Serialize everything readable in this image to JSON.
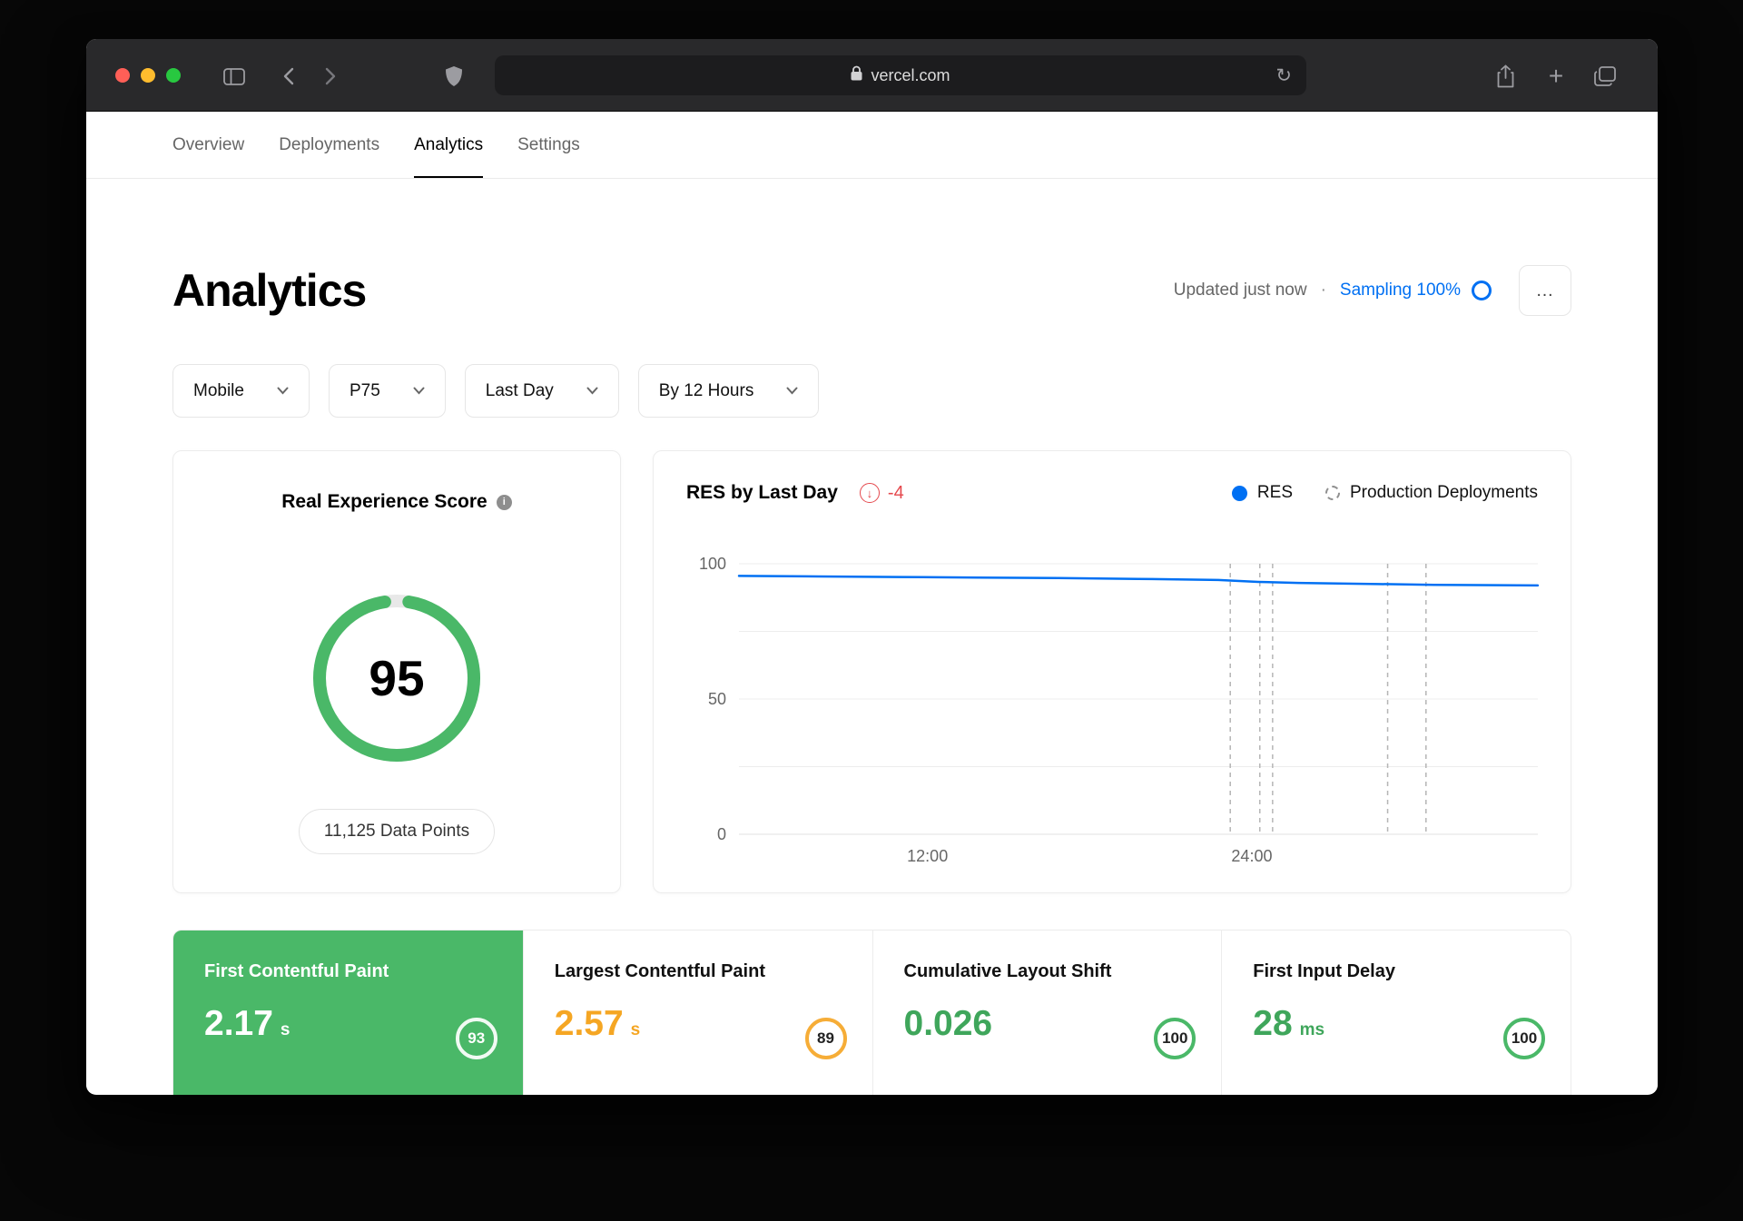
{
  "browser": {
    "url": "vercel.com",
    "refresh_glyph": "↻",
    "plus_glyph": "+"
  },
  "nav": {
    "tabs": [
      {
        "label": "Overview",
        "active": false
      },
      {
        "label": "Deployments",
        "active": false
      },
      {
        "label": "Analytics",
        "active": true
      },
      {
        "label": "Settings",
        "active": false
      }
    ]
  },
  "header": {
    "title": "Analytics",
    "updated": "Updated just now",
    "separator": "·",
    "sampling": "Sampling 100%",
    "more_glyph": "…"
  },
  "filters": [
    {
      "label": "Mobile"
    },
    {
      "label": "P75"
    },
    {
      "label": "Last Day"
    },
    {
      "label": "By 12 Hours"
    }
  ],
  "res_card": {
    "title": "Real Experience Score",
    "info_glyph": "i",
    "score": "95",
    "data_points": "11,125 Data Points"
  },
  "chart_card": {
    "title": "RES by Last Day",
    "delta": "-4",
    "delta_glyph": "↓",
    "legend_res": "RES",
    "legend_deployments": "Production Deployments"
  },
  "chart_data": {
    "type": "line",
    "title": "RES by Last Day",
    "ylim": [
      0,
      100
    ],
    "y_ticks": [
      100,
      50,
      0
    ],
    "gridline_values": [
      100,
      75,
      50,
      25,
      0
    ],
    "x_tick_labels": [
      {
        "label": "12:00",
        "f": 0.236
      },
      {
        "label": "24:00",
        "f": 0.642
      }
    ],
    "series": [
      {
        "name": "RES",
        "color": "#0070f3",
        "x_fraction": [
          0,
          0.1,
          0.2,
          0.3,
          0.4,
          0.5,
          0.6,
          0.65,
          0.7,
          0.8,
          0.87,
          1.0
        ],
        "values": [
          95.5,
          95.3,
          95.1,
          94.9,
          94.7,
          94.4,
          94.0,
          93.3,
          92.9,
          92.5,
          92.2,
          92.0
        ]
      }
    ],
    "deployments_fractions": [
      0.615,
      0.652,
      0.668,
      0.812,
      0.86
    ],
    "legend_position": "top-right",
    "grid": true
  },
  "metrics": [
    {
      "label": "First Contentful Paint",
      "value": "2.17",
      "unit": "s",
      "score": "93",
      "state": "selected"
    },
    {
      "label": "Largest Contentful Paint",
      "value": "2.57",
      "unit": "s",
      "score": "89",
      "state": "warning"
    },
    {
      "label": "Cumulative Layout Shift",
      "value": "0.026",
      "unit": "",
      "score": "100",
      "state": "good"
    },
    {
      "label": "First Input Delay",
      "value": "28",
      "unit": "ms",
      "score": "100",
      "state": "good"
    }
  ],
  "colors": {
    "accent_blue": "#0070f3",
    "score_green": "#4ab868",
    "warning_orange": "#f5a623",
    "delta_red": "#e5484d"
  }
}
